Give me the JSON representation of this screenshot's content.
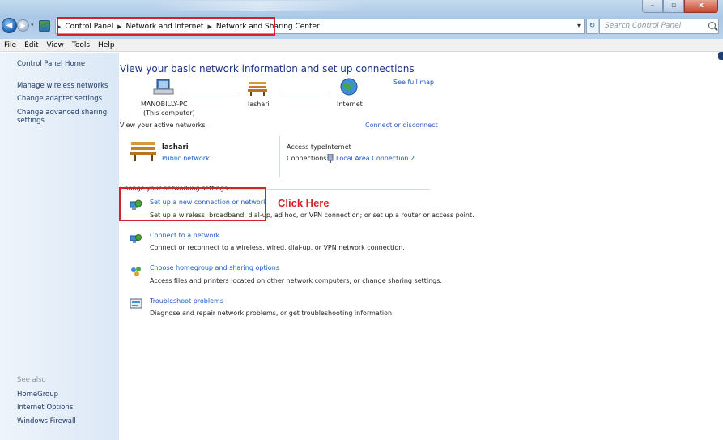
{
  "window": {
    "controls": {
      "minimize": "–",
      "maximize": "▫",
      "close": "x"
    }
  },
  "address": {
    "crumbs": [
      "Control Panel",
      "Network and Internet",
      "Network and Sharing Center"
    ],
    "search_placeholder": "Search Control Panel"
  },
  "menu": [
    {
      "label": "File"
    },
    {
      "label": "Edit"
    },
    {
      "label": "View"
    },
    {
      "label": "Tools"
    },
    {
      "label": "Help"
    }
  ],
  "sidebar": {
    "home": "Control Panel Home",
    "links": [
      "Manage wireless networks",
      "Change adapter settings",
      "Change advanced sharing settings"
    ],
    "see_also_title": "See also",
    "see_also": [
      "HomeGroup",
      "Internet Options",
      "Windows Firewall"
    ]
  },
  "main": {
    "title": "View your basic network information and set up connections",
    "see_full_map": "See full map",
    "map": {
      "computer_name": "MANOBILLY-PC",
      "computer_sub": "(This computer)",
      "network_name": "lashari",
      "internet": "Internet"
    },
    "active_section": {
      "label": "View your active networks",
      "link": "Connect or disconnect",
      "network_name": "lashari",
      "network_type": "Public network",
      "access_type_label": "Access type:",
      "access_type_value": "Internet",
      "connections_label": "Connections:",
      "connections_value": "Local Area Connection 2"
    },
    "settings_section": {
      "label": "Change your networking settings"
    },
    "tasks": [
      {
        "title": "Set up a new connection or network",
        "desc": "Set up a wireless, broadband, dial-up, ad hoc, or VPN connection; or set up a router or access point."
      },
      {
        "title": "Connect to a network",
        "desc": "Connect or reconnect to a wireless, wired, dial-up, or VPN network connection."
      },
      {
        "title": "Choose homegroup and sharing options",
        "desc": "Access files and printers located on other network computers, or change sharing settings."
      },
      {
        "title": "Troubleshoot problems",
        "desc": "Diagnose and repair network problems, or get troubleshooting information."
      }
    ],
    "annotation": "Click Here"
  },
  "colors": {
    "link": "#1e5bc6",
    "title": "#1e3287",
    "annotation": "#d0232b"
  }
}
